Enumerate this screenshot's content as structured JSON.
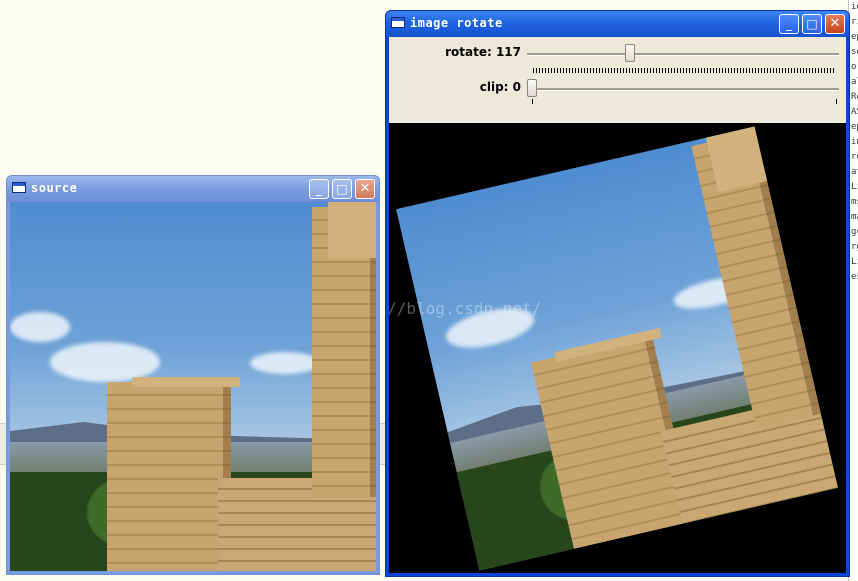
{
  "background": {
    "right_strip_text": [
      "io",
      "ri",
      "ep",
      "so",
      "or",
      "al",
      "Re",
      "AS",
      "ep",
      "in",
      "ro",
      "at",
      "Li",
      "ms",
      "ma",
      "gc",
      "rg",
      "Li",
      "es"
    ]
  },
  "source_window": {
    "title": "source",
    "buttons": {
      "minimize": "_",
      "maximize": "□",
      "close": "✕"
    }
  },
  "rotate_window": {
    "title": "image rotate",
    "buttons": {
      "minimize": "_",
      "maximize": "□",
      "close": "✕"
    },
    "controls": {
      "rotate": {
        "label": "rotate: 117",
        "value": 117,
        "max": 360
      },
      "clip": {
        "label": "clip: 0",
        "value": 0,
        "max": 100
      }
    },
    "watermark": "http://blog.csdn.net/",
    "rotation_degrees": 117
  },
  "colors": {
    "titlebar_active": "#1f64e0",
    "titlebar_inactive": "#7a9be0",
    "panel": "#ece9d8",
    "close_button": "#c8401e"
  }
}
